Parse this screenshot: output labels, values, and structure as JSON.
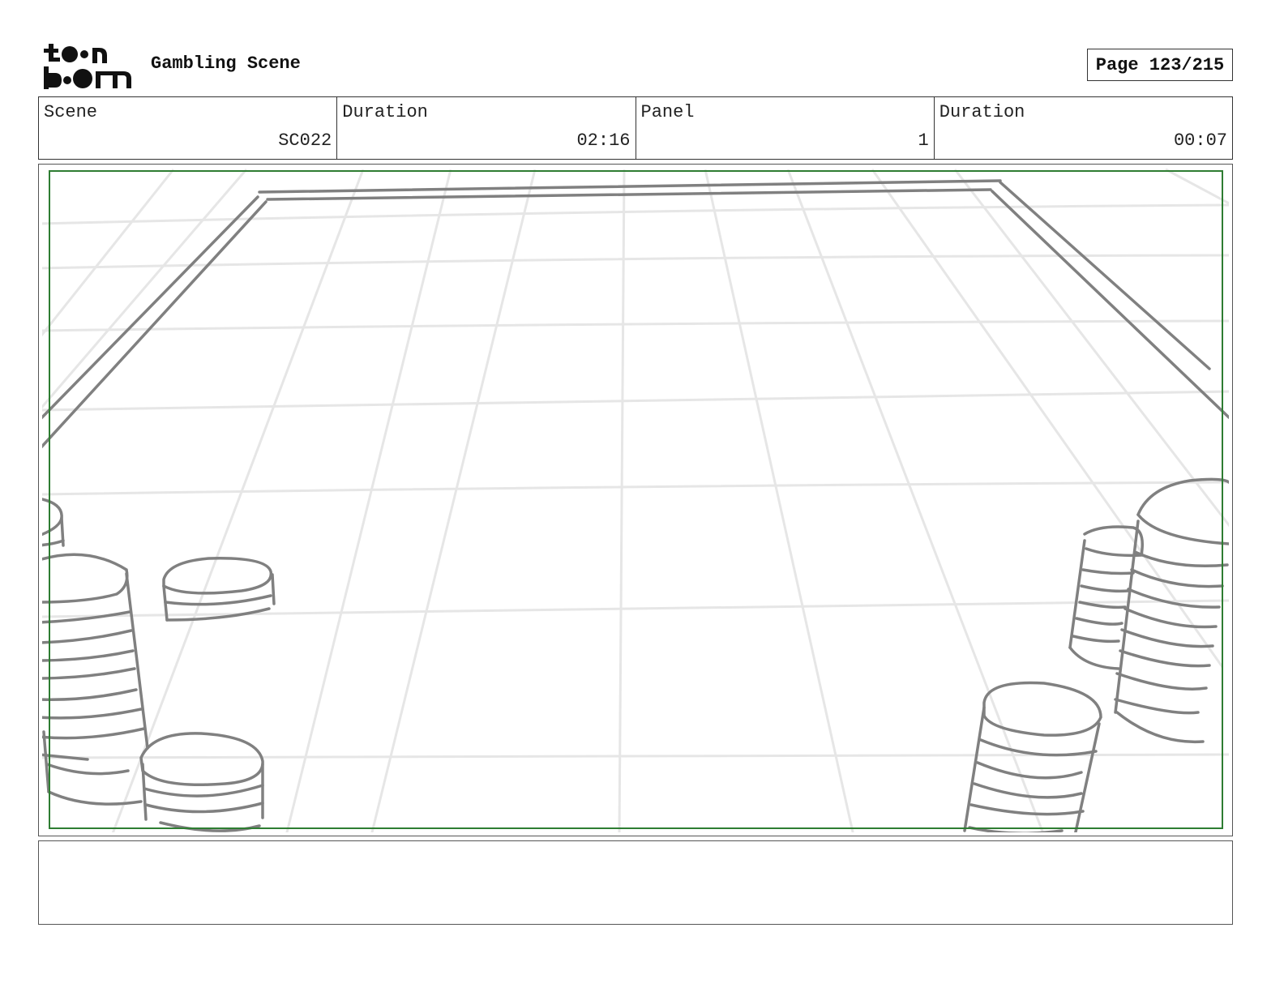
{
  "header": {
    "logo_text": "toon boom",
    "project_title": "Gambling Scene",
    "page_label": "Page 123/215"
  },
  "info": {
    "scene_label": "Scene",
    "scene_value": "SC022",
    "scene_duration_label": "Duration",
    "scene_duration_value": "02:16",
    "panel_label": "Panel",
    "panel_value": "1",
    "panel_duration_label": "Duration",
    "panel_duration_value": "00:07"
  },
  "panel": {
    "drawing_subject": "poker-table-with-chip-stacks",
    "safe_area_color": "#2e7d32",
    "sketch_color": "#808080",
    "grid_color": "#e6e6e6"
  },
  "notes": {
    "text": ""
  }
}
